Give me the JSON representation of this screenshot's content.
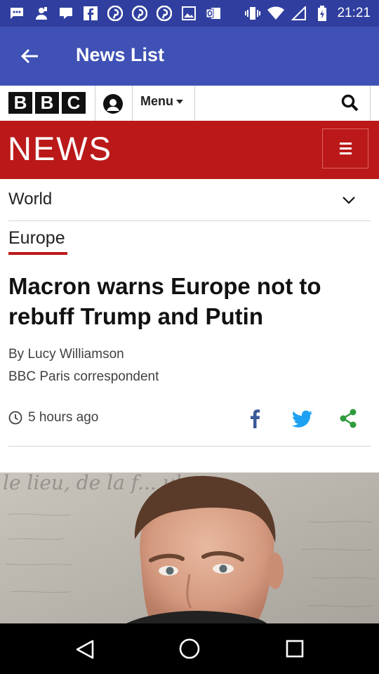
{
  "status_bar": {
    "time": "21:21",
    "icons": [
      "sms-icon",
      "user-notification-icon",
      "chat-icon",
      "facebook-icon",
      "pinterest-icon",
      "pinterest-icon",
      "pinterest-icon",
      "image-icon",
      "outlook-icon",
      "vibrate-icon",
      "wifi-icon",
      "signal-icon",
      "battery-icon"
    ]
  },
  "app_bar": {
    "title": "News List",
    "back_icon": "arrow-left-icon"
  },
  "bbc_nav": {
    "logo_letters": [
      "B",
      "B",
      "C"
    ],
    "menu_label": "Menu",
    "account_icon": "account-icon",
    "search_icon": "search-icon"
  },
  "news_banner": {
    "wordmark": "NEWS",
    "color": "#bb1919"
  },
  "article": {
    "section": "World",
    "subsection": "Europe",
    "headline": "Macron warns Europe not to rebuff Trump and Putin",
    "byline": "By Lucy Williamson",
    "role": "BBC Paris correspondent",
    "published": "5 hours ago",
    "share": {
      "facebook_color": "#3b5998",
      "twitter_color": "#1da1f2",
      "share_color": "#2e9b3c"
    },
    "image_text": "le lieu, de la f... ule ma"
  },
  "colors": {
    "status_bar": "#303f9f",
    "app_bar": "#3f51b5",
    "bbc_red": "#bb1919"
  }
}
